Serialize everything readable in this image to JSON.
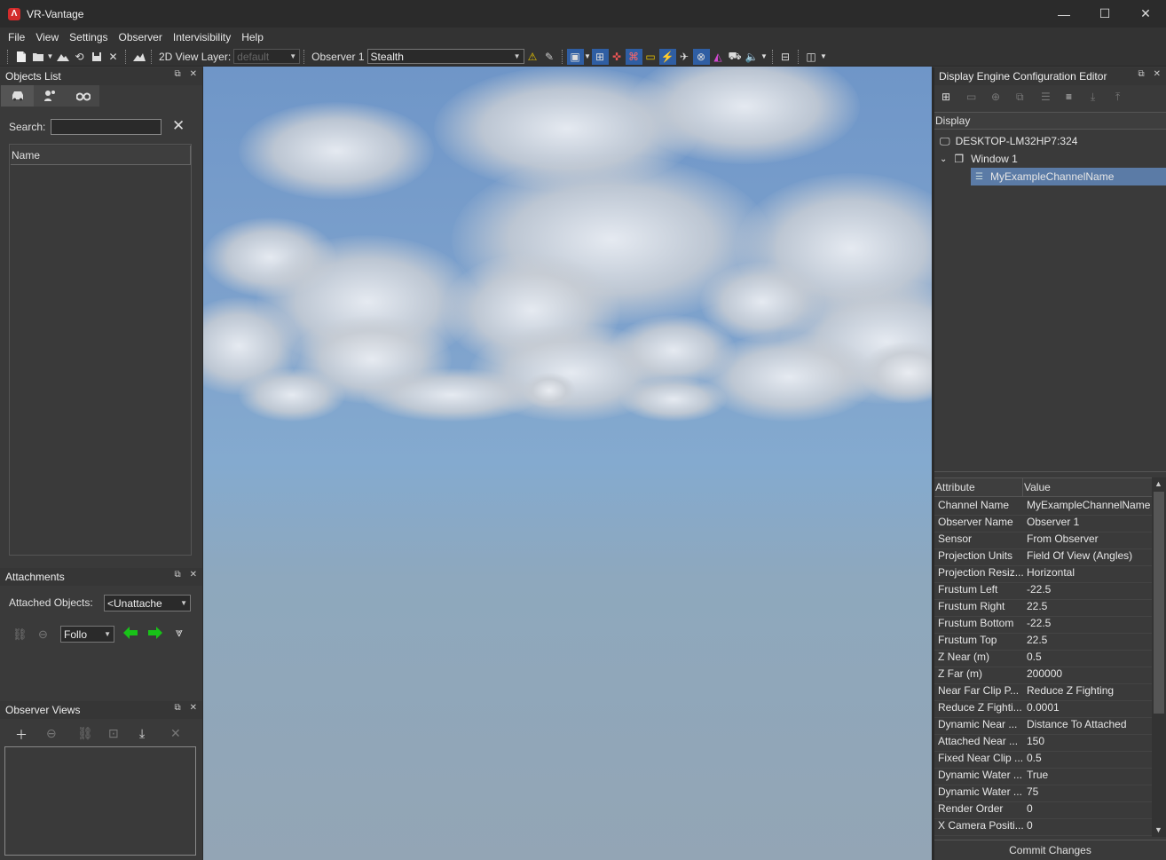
{
  "app": {
    "title": "VR-Vantage"
  },
  "window_controls": {
    "minimize": "—",
    "maximize": "☐",
    "close": "✕"
  },
  "menu": [
    "File",
    "View",
    "Settings",
    "Observer",
    "Intervisibility",
    "Help"
  ],
  "toolbar": {
    "view_layer_label": "2D View Layer:",
    "view_layer_value": "default",
    "observer_label": "Observer 1",
    "observer_mode": "Stealth"
  },
  "objects_list": {
    "title": "Objects List",
    "search_label": "Search:",
    "search_value": "",
    "column_name": "Name"
  },
  "attachments": {
    "title": "Attachments",
    "attached_label": "Attached Objects:",
    "attached_value": "<Unattache",
    "follow_value": "Follo"
  },
  "observer_views": {
    "title": "Observer Views"
  },
  "display_editor": {
    "title": "Display Engine Configuration Editor",
    "tree_header": "Display",
    "tree": {
      "host": "DESKTOP-LM32HP7:324",
      "window": "Window 1",
      "channel": "MyExampleChannelName"
    },
    "attr_header": "Attribute",
    "value_header": "Value",
    "attributes": [
      {
        "a": "Channel Name",
        "v": "MyExampleChannelName"
      },
      {
        "a": "Observer Name",
        "v": "Observer 1"
      },
      {
        "a": "Sensor",
        "v": "From Observer"
      },
      {
        "a": "Projection Units",
        "v": "Field Of View (Angles)"
      },
      {
        "a": "Projection Resiz...",
        "v": "Horizontal"
      },
      {
        "a": "Frustum Left",
        "v": "-22.5"
      },
      {
        "a": "Frustum Right",
        "v": "22.5"
      },
      {
        "a": "Frustum Bottom",
        "v": "-22.5"
      },
      {
        "a": "Frustum Top",
        "v": "22.5"
      },
      {
        "a": "Z Near (m)",
        "v": "0.5"
      },
      {
        "a": "Z Far (m)",
        "v": "200000"
      },
      {
        "a": "Near Far Clip P...",
        "v": "Reduce Z Fighting"
      },
      {
        "a": "Reduce Z Fighti...",
        "v": "0.0001"
      },
      {
        "a": "Dynamic Near ...",
        "v": "Distance To Attached"
      },
      {
        "a": "Attached Near ...",
        "v": "150"
      },
      {
        "a": "Fixed Near Clip ...",
        "v": "0.5"
      },
      {
        "a": "Dynamic Water ...",
        "v": "True"
      },
      {
        "a": "Dynamic Water ...",
        "v": "75"
      },
      {
        "a": "Render Order",
        "v": "0"
      },
      {
        "a": "X Camera Positi...",
        "v": "0"
      }
    ],
    "commit": "Commit Changes"
  },
  "colors": {
    "selection": "#5b7ba6",
    "accent_green": "#18c218"
  }
}
